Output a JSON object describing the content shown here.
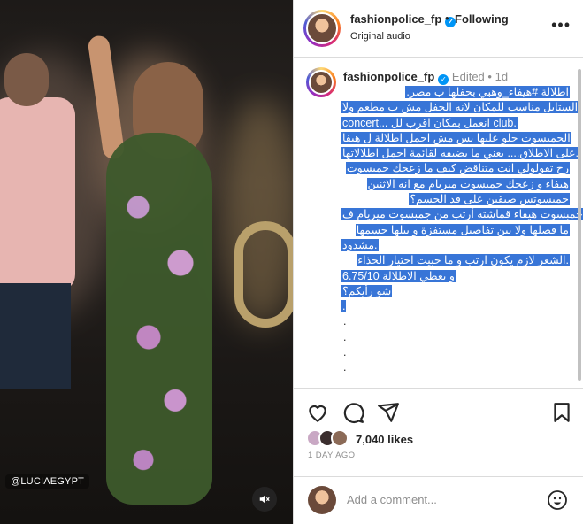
{
  "post": {
    "username": "fashionpolice_fp",
    "following_label": "Following",
    "audio_label": "Original audio",
    "more_label": "•••",
    "watermark": "@LUCIAEGYPT",
    "caption": {
      "username": "fashionpolice_fp",
      "edited_label": "Edited",
      "time": "1d",
      "lines": [
        ".اطلالة #هيفاء_وهبي بحفلها ب مصر",
        "الستايل مناسب للمكان لانه الحفل مش ب مطعم ولا",
        "concert... انعمل بمكان اقرب لل club.",
        "الجمبسوت حلو عليها بس مش اجمل اطلالة ل هيفا",
        "على الاطلاق.... يعني ما بضيفه لقائمة اجمل اطلالاتها.",
        "رح تقولولي انت متناقض كيف ما زعجك جمبسوت",
        "هيفاء و زعجك جمبسوت ميريام مع انه الاثنين",
        "جمبسوتس ضيقين على قد الجسم؟",
        "جمبسوت هيفاء قماشته أرتب من جمبسوت ميريام ف",
        "ما فصلها ولا بين تفاصيل مستفزة و بيلها جسمها",
        "مشدود.",
        "الشعر لازم يكون ارتب و ما حبيت اختيار الحذاء.",
        "و بعطي الاطلالة 6.75/10",
        "شو رأيكم؟",
        "."
      ],
      "dots": [
        ".",
        ".",
        ".",
        "."
      ]
    },
    "likes": "7,040 likes",
    "time_ago": "1 DAY AGO",
    "comment_placeholder": "Add a comment..."
  }
}
